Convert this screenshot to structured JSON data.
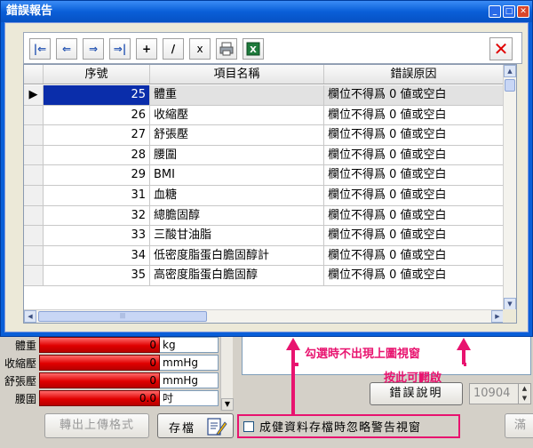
{
  "dialog": {
    "title": "錯誤報告",
    "toolbar": {
      "first": "|⇐",
      "prev": "⇐",
      "next": "⇒",
      "last": "⇒|",
      "add": "+",
      "edit": "/",
      "delete": "x",
      "close": "✕"
    },
    "grid": {
      "columns": [
        "序號",
        "項目名稱",
        "錯誤原因"
      ],
      "rows": [
        {
          "no": "25",
          "item": "體重",
          "reason": "欄位不得爲 0 値或空白"
        },
        {
          "no": "26",
          "item": "收縮壓",
          "reason": "欄位不得爲 0 値或空白"
        },
        {
          "no": "27",
          "item": "舒張壓",
          "reason": "欄位不得爲 0 値或空白"
        },
        {
          "no": "28",
          "item": "腰圍",
          "reason": "欄位不得爲 0 値或空白"
        },
        {
          "no": "29",
          "item": "BMI",
          "reason": "欄位不得爲 0 値或空白"
        },
        {
          "no": "31",
          "item": "血糖",
          "reason": "欄位不得爲 0 値或空白"
        },
        {
          "no": "32",
          "item": "總膽固醇",
          "reason": "欄位不得爲 0 値或空白"
        },
        {
          "no": "33",
          "item": "三酸甘油脂",
          "reason": "欄位不得爲 0 値或空白"
        },
        {
          "no": "34",
          "item": "低密度脂蛋白膽固醇計",
          "reason": "欄位不得爲 0 値或空白"
        },
        {
          "no": "35",
          "item": "高密度脂蛋白膽固醇",
          "reason": "欄位不得爲 0 値或空白"
        }
      ],
      "selected_row_index": 0
    }
  },
  "background_form": {
    "measurements": [
      {
        "label": "體重",
        "value": "0",
        "unit": "kg"
      },
      {
        "label": "收縮壓",
        "value": "0",
        "unit": "mmHg"
      },
      {
        "label": "舒張壓",
        "value": "0",
        "unit": "mmHg"
      },
      {
        "label": "腰圍",
        "value": "0.0",
        "unit": "吋"
      }
    ],
    "error_button_label": "錯誤說明",
    "number_field_value": "10904",
    "export_button_label": "轉出上傳格式",
    "save_button_label": "存檔",
    "ignore_warning_checkbox_label": "成健資料存檔時忽略警告視窗",
    "right_button_partial_label": "滿"
  },
  "annotations": {
    "callout_no_popup": "勾選時不出現上圖視窗",
    "callout_click_to_open": "按此可開啟",
    "accent_color": "#e8136f"
  }
}
